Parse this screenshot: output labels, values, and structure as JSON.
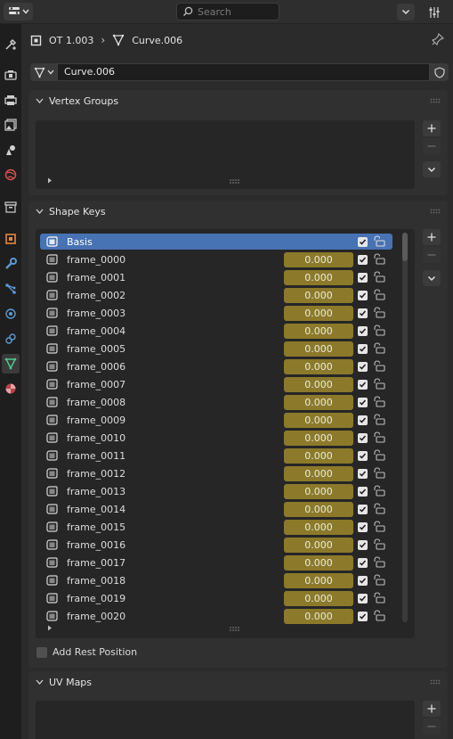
{
  "header": {
    "search_placeholder": "Search"
  },
  "breadcrumb": {
    "object": "OT 1.003",
    "data": "Curve.006"
  },
  "datablock": {
    "name": "Curve.006"
  },
  "vertex_groups": {
    "title": "Vertex Groups"
  },
  "shape_keys": {
    "title": "Shape Keys",
    "basis": "Basis",
    "items": [
      {
        "name": "frame_0000",
        "value": "0.000"
      },
      {
        "name": "frame_0001",
        "value": "0.000"
      },
      {
        "name": "frame_0002",
        "value": "0.000"
      },
      {
        "name": "frame_0003",
        "value": "0.000"
      },
      {
        "name": "frame_0004",
        "value": "0.000"
      },
      {
        "name": "frame_0005",
        "value": "0.000"
      },
      {
        "name": "frame_0006",
        "value": "0.000"
      },
      {
        "name": "frame_0007",
        "value": "0.000"
      },
      {
        "name": "frame_0008",
        "value": "0.000"
      },
      {
        "name": "frame_0009",
        "value": "0.000"
      },
      {
        "name": "frame_0010",
        "value": "0.000"
      },
      {
        "name": "frame_0011",
        "value": "0.000"
      },
      {
        "name": "frame_0012",
        "value": "0.000"
      },
      {
        "name": "frame_0013",
        "value": "0.000"
      },
      {
        "name": "frame_0014",
        "value": "0.000"
      },
      {
        "name": "frame_0015",
        "value": "0.000"
      },
      {
        "name": "frame_0016",
        "value": "0.000"
      },
      {
        "name": "frame_0017",
        "value": "0.000"
      },
      {
        "name": "frame_0018",
        "value": "0.000"
      },
      {
        "name": "frame_0019",
        "value": "0.000"
      },
      {
        "name": "frame_0020",
        "value": "0.000"
      }
    ],
    "add_rest_position": "Add Rest Position"
  },
  "uv_maps": {
    "title": "UV Maps"
  },
  "colors": {
    "selected_row": "#4772b3",
    "value_field": "#8c7a2a",
    "background": "#2b2b2b"
  },
  "icons": [
    "editor-type-icon",
    "search-icon",
    "filter-icon",
    "pin-icon",
    "object-icon",
    "curve-data-icon",
    "shield-icon",
    "shape-key-icon",
    "lock-icon",
    "plus-icon",
    "minus-icon",
    "chevron-down-icon"
  ]
}
